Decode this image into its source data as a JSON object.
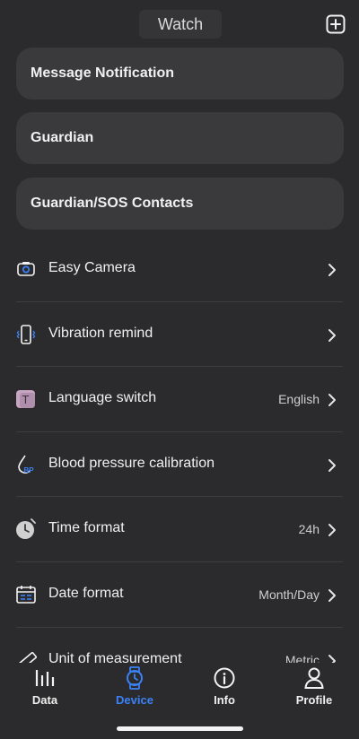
{
  "header": {
    "title": "Watch",
    "add_icon": "plus-square-icon"
  },
  "cards": [
    {
      "label": "Message Notification"
    },
    {
      "label": "Guardian"
    },
    {
      "label": "Guardian/SOS Contacts"
    }
  ],
  "settings": [
    {
      "label": "Easy Camera",
      "value": "",
      "icon": "camera-icon"
    },
    {
      "label": "Vibration remind",
      "value": "",
      "icon": "phone-vibrate-icon"
    },
    {
      "label": "Language switch",
      "value": "English",
      "icon": "text-t-icon"
    },
    {
      "label": "Blood pressure calibration",
      "value": "",
      "icon": "blood-drop-bp-icon"
    },
    {
      "label": "Time format",
      "value": "24h",
      "icon": "clock-icon"
    },
    {
      "label": "Date format",
      "value": "Month/Day",
      "icon": "calendar-icon"
    },
    {
      "label": "Unit of measurement",
      "value": "Metric",
      "icon": "ruler-icon"
    }
  ],
  "tabs": [
    {
      "label": "Data",
      "icon": "bar-chart-icon",
      "active": false
    },
    {
      "label": "Device",
      "icon": "watch-icon",
      "active": true
    },
    {
      "label": "Info",
      "icon": "info-icon",
      "active": false
    },
    {
      "label": "Profile",
      "icon": "person-icon",
      "active": false
    }
  ],
  "colors": {
    "background": "#2b2b2d",
    "card": "#3a3a3c",
    "accent": "#3b82f6"
  }
}
